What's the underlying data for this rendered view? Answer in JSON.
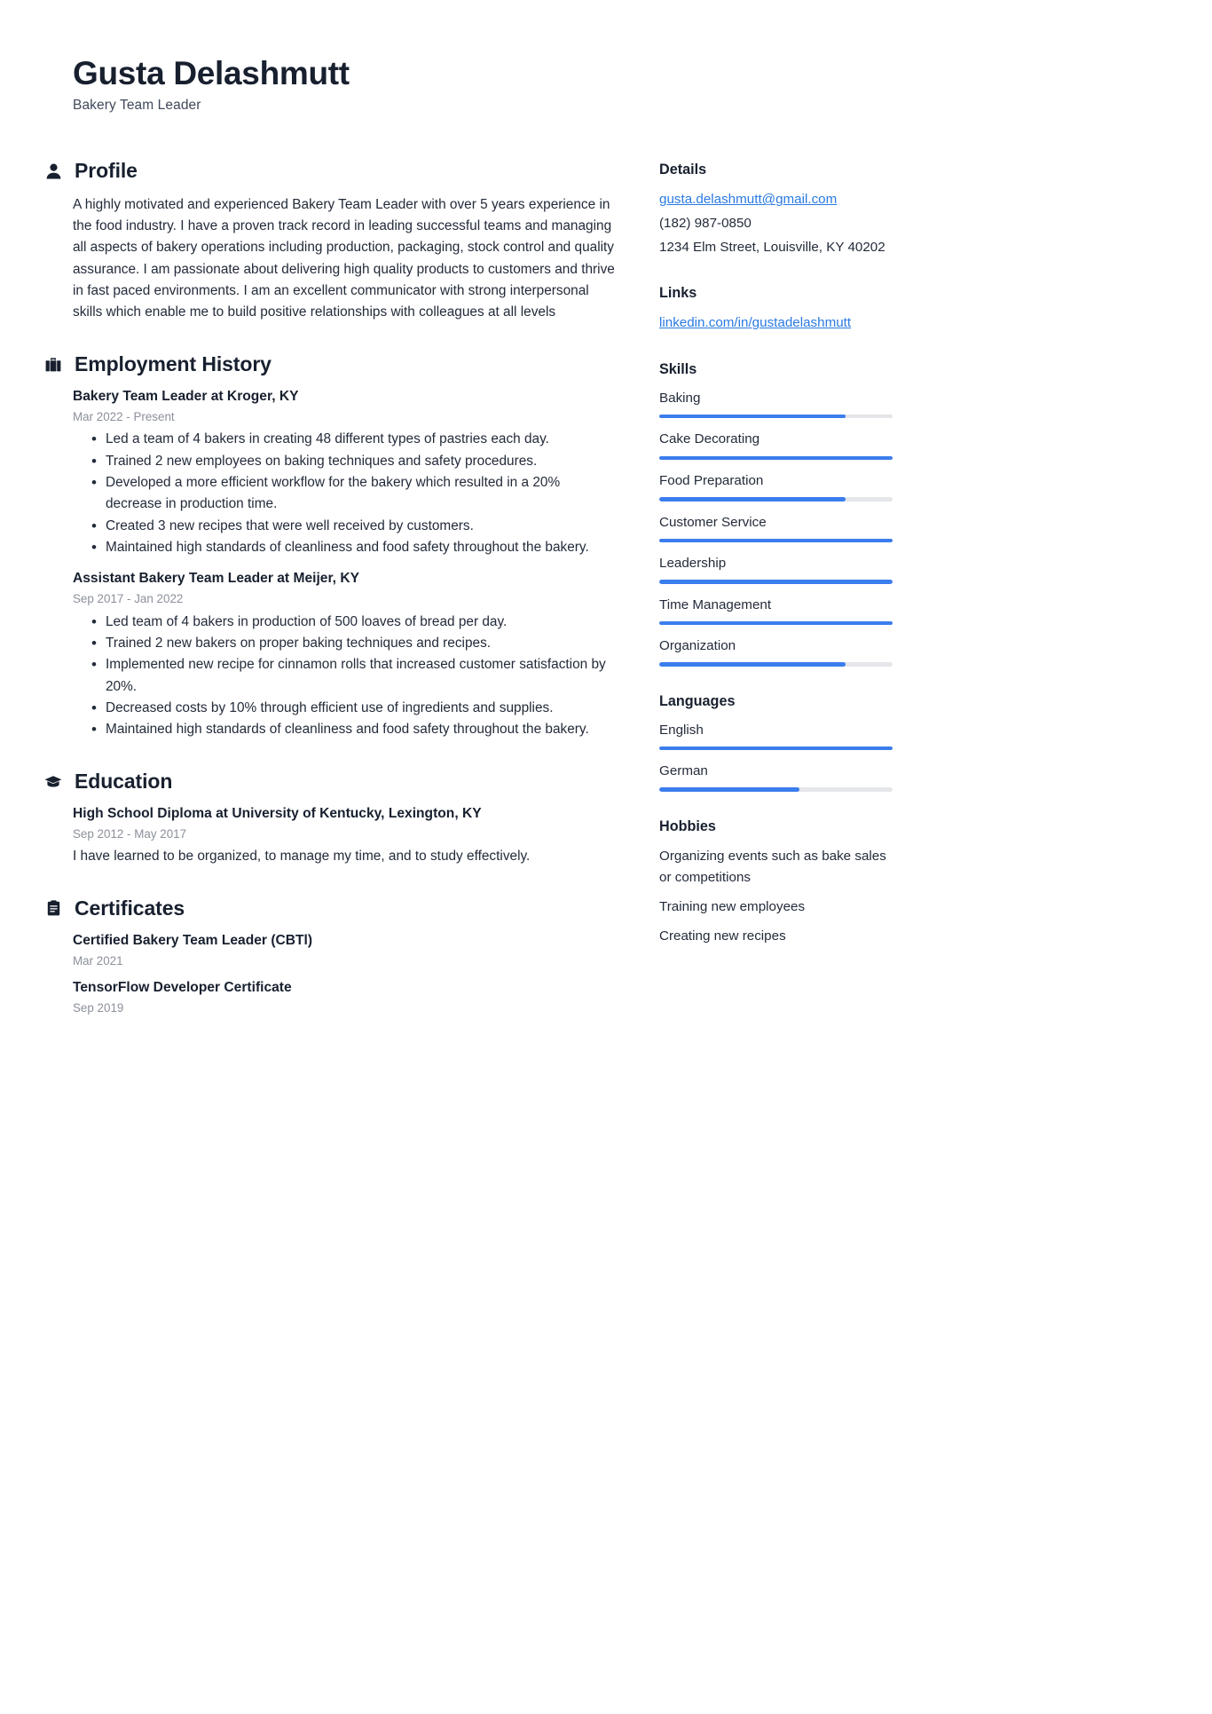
{
  "header": {
    "full_name": "Gusta Delashmutt",
    "job_title": "Bakery Team Leader"
  },
  "main": {
    "profile": {
      "heading": "Profile",
      "icon": "person-icon",
      "text": "A highly motivated and experienced Bakery Team Leader with over 5 years experience in the food industry. I have a proven track record in leading successful teams and managing all aspects of bakery operations including production, packaging, stock control and quality assurance. I am passionate about delivering high quality products to customers and thrive in fast paced environments. I am an excellent communicator with strong interpersonal skills which enable me to build positive relationships with colleagues at all levels"
    },
    "employment": {
      "heading": "Employment History",
      "icon": "briefcase-icon",
      "entries": [
        {
          "title": "Bakery Team Leader at Kroger, KY",
          "date": "Mar 2022 - Present",
          "bullets": [
            "Led a team of 4 bakers in creating 48 different types of pastries each day.",
            "Trained 2 new employees on baking techniques and safety procedures.",
            "Developed a more efficient workflow for the bakery which resulted in a 20% decrease in production time.",
            "Created 3 new recipes that were well received by customers.",
            "Maintained high standards of cleanliness and food safety throughout the bakery."
          ]
        },
        {
          "title": "Assistant Bakery Team Leader at Meijer, KY",
          "date": "Sep 2017 - Jan 2022",
          "bullets": [
            "Led team of 4 bakers in production of 500 loaves of bread per day.",
            "Trained 2 new bakers on proper baking techniques and recipes.",
            "Implemented new recipe for cinnamon rolls that increased customer satisfaction by 20%.",
            "Decreased costs by 10% through efficient use of ingredients and supplies.",
            "Maintained high standards of cleanliness and food safety throughout the bakery."
          ]
        }
      ]
    },
    "education": {
      "heading": "Education",
      "icon": "graduation-cap-icon",
      "entries": [
        {
          "title": "High School Diploma at University of Kentucky, Lexington, KY",
          "date": "Sep 2012 - May 2017",
          "description": "I have learned to be organized, to manage my time, and to study effectively."
        }
      ]
    },
    "certificates": {
      "heading": "Certificates",
      "icon": "clipboard-icon",
      "entries": [
        {
          "title": "Certified Bakery Team Leader (CBTl)",
          "date": "Mar 2021"
        },
        {
          "title": "TensorFlow Developer Certificate",
          "date": "Sep 2019"
        }
      ]
    }
  },
  "sidebar": {
    "details": {
      "heading": "Details",
      "email": "gusta.delashmutt@gmail.com",
      "phone": "(182) 987-0850",
      "address": "1234 Elm Street, Louisville, KY 40202"
    },
    "links": {
      "heading": "Links",
      "items": [
        {
          "label": "linkedin.com/in/gustadelashmutt"
        }
      ]
    },
    "skills": {
      "heading": "Skills",
      "items": [
        {
          "name": "Baking",
          "level": 80
        },
        {
          "name": "Cake Decorating",
          "level": 100
        },
        {
          "name": "Food Preparation",
          "level": 80
        },
        {
          "name": "Customer Service",
          "level": 100
        },
        {
          "name": "Leadership",
          "level": 100
        },
        {
          "name": "Time Management",
          "level": 100
        },
        {
          "name": "Organization",
          "level": 80
        }
      ]
    },
    "languages": {
      "heading": "Languages",
      "items": [
        {
          "name": "English",
          "level": 100
        },
        {
          "name": "German",
          "level": 60
        }
      ]
    },
    "hobbies": {
      "heading": "Hobbies",
      "items": [
        "Organizing events such as bake sales or competitions",
        "Training new employees",
        "Creating new recipes"
      ]
    }
  },
  "colors": {
    "accent": "#3b7ded",
    "link": "#2a7ae2",
    "heading": "#18202f",
    "muted": "#8b909a",
    "track": "#e4e6e9"
  }
}
